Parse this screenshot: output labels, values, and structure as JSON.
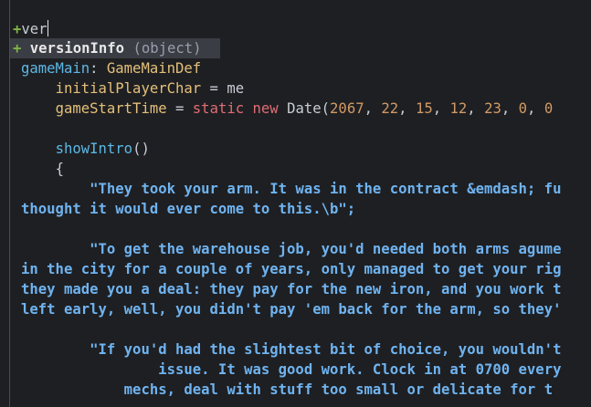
{
  "editor": {
    "input_line": "ver",
    "input_marker": "+",
    "autocomplete": {
      "marker": "+",
      "name": "versionInfo",
      "type": "(object)"
    },
    "lines": {
      "l3_ident": "gameMain",
      "l3_colon": ": ",
      "l3_class": "GameMainDef",
      "l4_ident": "initialPlayerChar",
      "l4_rest": " = me",
      "l5_ident": "gameStartTime",
      "l5_eq": " = ",
      "l5_kw1": "static",
      "l5_sp": " ",
      "l5_kw2": "new",
      "l5_sp2": " ",
      "l5_class": "Date",
      "l5_open": "(",
      "l5_n1": "2067",
      "l5_c1": ", ",
      "l5_n2": "22",
      "l5_c2": ", ",
      "l5_n3": "15",
      "l5_c3": ", ",
      "l5_n4": "12",
      "l5_c4": ", ",
      "l5_n5": "23",
      "l5_c5": ", ",
      "l5_n6": "0",
      "l5_c6": ", ",
      "l5_n7": "0",
      "l7_ident": "showIntro",
      "l7_rest": "()",
      "l8_brace": "{",
      "s1a": "\"They took your arm. It was in the contract &emdash; fu",
      "s1b": "thought it would ever come to this.\\b\";",
      "s2a": "\"To get the warehouse job, you'd needed both arms agume",
      "s2b": "in the city for a couple of years, only managed to get your rig",
      "s2c": "they made you a deal: they pay for the new iron, and you work t",
      "s2d": "left early, well, you didn't pay 'em back for the arm, so they'",
      "s3a": "\"If you'd had the slightest bit of choice, you wouldn't",
      "s3b": "issue. It was good work. Clock in at 0700 every",
      "s3c": "mechs, deal with stuff too small or delicate for t"
    }
  }
}
